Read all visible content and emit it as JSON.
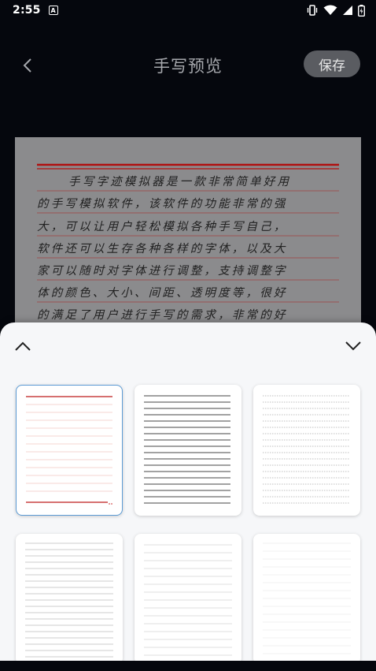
{
  "status": {
    "time": "2:55",
    "app_badge": "A",
    "icons": [
      "vibrate-icon",
      "wifi-icon",
      "signal-icon",
      "battery-icon"
    ]
  },
  "topbar": {
    "title": "手写预览",
    "save_label": "保存"
  },
  "preview": {
    "lines": [
      "手写字迹模拟器是一款非常简单好用",
      "的手写模拟软件，该软件的功能非常的强",
      "大，可以让用户轻松模拟各种手写自己，",
      "软件还可以生存各种各样的字体，以及大",
      "家可以随时对字体进行调整，支持调整字",
      "体的颜色、大小、间距、透明度等，很好",
      "的满足了用户进行手写的需求，非常的好"
    ]
  },
  "sheet": {
    "templates": [
      {
        "name": "red-lined-paper",
        "selected": true
      },
      {
        "name": "dark-lined-paper",
        "selected": false
      },
      {
        "name": "dotted-lined-paper",
        "selected": false
      },
      {
        "name": "light-lined-paper",
        "selected": false
      },
      {
        "name": "faint-lined-paper",
        "selected": false
      },
      {
        "name": "plain-paper",
        "selected": false
      }
    ]
  },
  "colors": {
    "background": "#05070d",
    "save_button": "#5a5c61",
    "red_rule": "#c0392b",
    "selected_border": "#5b9bd5",
    "sheet": "#f6f7f9"
  }
}
